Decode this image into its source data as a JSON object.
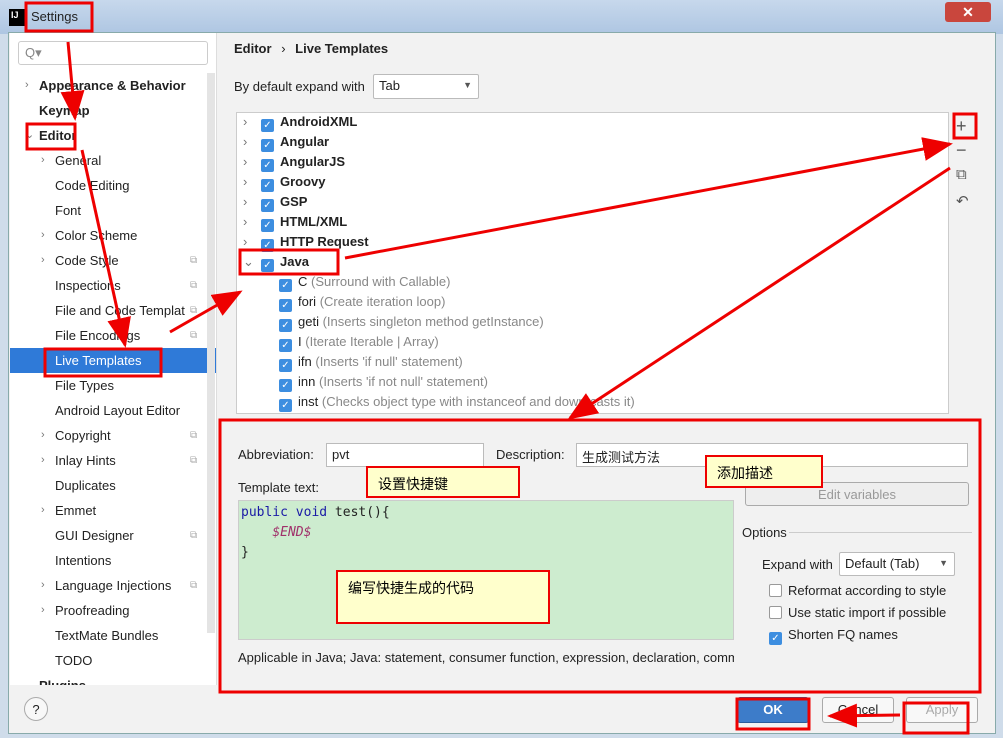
{
  "window": {
    "title": "Settings",
    "close": "✕"
  },
  "search": {
    "placeholder": "Q▾"
  },
  "sidebar": {
    "items": [
      {
        "label": "Appearance & Behavior",
        "bold": true,
        "level": 0,
        "arrow": true
      },
      {
        "label": "Keymap",
        "bold": true,
        "level": 0
      },
      {
        "label": "Editor",
        "bold": true,
        "level": 0,
        "expanded": true
      },
      {
        "label": "General",
        "level": 1,
        "arrow": true
      },
      {
        "label": "Code Editing",
        "level": 1
      },
      {
        "label": "Font",
        "level": 1
      },
      {
        "label": "Color Scheme",
        "level": 1,
        "arrow": true
      },
      {
        "label": "Code Style",
        "level": 1,
        "arrow": true,
        "cfg": true
      },
      {
        "label": "Inspections",
        "level": 1,
        "cfg": true
      },
      {
        "label": "File and Code Templat",
        "level": 1,
        "cfg": true
      },
      {
        "label": "File Encodings",
        "level": 1,
        "cfg": true
      },
      {
        "label": "Live Templates",
        "level": 1,
        "selected": true
      },
      {
        "label": "File Types",
        "level": 1
      },
      {
        "label": "Android Layout Editor",
        "level": 1
      },
      {
        "label": "Copyright",
        "level": 1,
        "arrow": true,
        "cfg": true
      },
      {
        "label": "Inlay Hints",
        "level": 1,
        "arrow": true,
        "cfg": true
      },
      {
        "label": "Duplicates",
        "level": 1
      },
      {
        "label": "Emmet",
        "level": 1,
        "arrow": true
      },
      {
        "label": "GUI Designer",
        "level": 1,
        "cfg": true
      },
      {
        "label": "Intentions",
        "level": 1
      },
      {
        "label": "Language Injections",
        "level": 1,
        "arrow": true,
        "cfg": true
      },
      {
        "label": "Proofreading",
        "level": 1,
        "arrow": true
      },
      {
        "label": "TextMate Bundles",
        "level": 1
      },
      {
        "label": "TODO",
        "level": 1
      },
      {
        "label": "Plugins",
        "bold": true,
        "level": 0
      }
    ]
  },
  "breadcrumb": {
    "parent": "Editor",
    "sep": "›",
    "current": "Live Templates"
  },
  "expand": {
    "label": "By default expand with",
    "value": "Tab"
  },
  "groups": [
    "AndroidXML",
    "Angular",
    "AngularJS",
    "Groovy",
    "GSP",
    "HTML/XML",
    "HTTP Request",
    "Java"
  ],
  "java_templates": [
    {
      "abbr": "C",
      "desc": "(Surround with Callable)"
    },
    {
      "abbr": "fori",
      "desc": "(Create iteration loop)"
    },
    {
      "abbr": "geti",
      "desc": "(Inserts singleton method getInstance)"
    },
    {
      "abbr": "I",
      "desc": "(Iterate Iterable | Array)"
    },
    {
      "abbr": "ifn",
      "desc": "(Inserts 'if null' statement)"
    },
    {
      "abbr": "inn",
      "desc": "(Inserts 'if not null' statement)"
    },
    {
      "abbr": "inst",
      "desc": "(Checks object type with instanceof and down-casts it)"
    }
  ],
  "tools": {
    "add": "+",
    "remove": "−",
    "copy": "⧉",
    "revert": "↶"
  },
  "editor": {
    "abbr_label": "Abbreviation:",
    "abbr_value": "pvt",
    "desc_label": "Description:",
    "desc_value": "生成测试方法",
    "template_label": "Template text:",
    "code_l1a": "public void",
    "code_l1b": " test(){",
    "code_l2": "$END$",
    "code_l3": "}",
    "edit_vars": "Edit variables",
    "options_label": "Options",
    "expand_label": "Expand with",
    "expand_value": "Default (Tab)",
    "opt_reformat": "Reformat according to style",
    "opt_static": "Use static import if possible",
    "opt_shorten": "Shorten FQ names",
    "applicable": "Applicable in Java; Java: statement, consumer function, expression, declaration, comm"
  },
  "buttons": {
    "help": "?",
    "ok": "OK",
    "cancel": "Cancel",
    "apply": "Apply"
  },
  "annotations": {
    "shortcut": "设置快捷键",
    "describe": "添加描述",
    "code": "编写快捷生成的代码"
  },
  "colors": {
    "accent": "#2f7ad8",
    "annotation": "#e00000",
    "code_bg": "#cdeccf"
  }
}
